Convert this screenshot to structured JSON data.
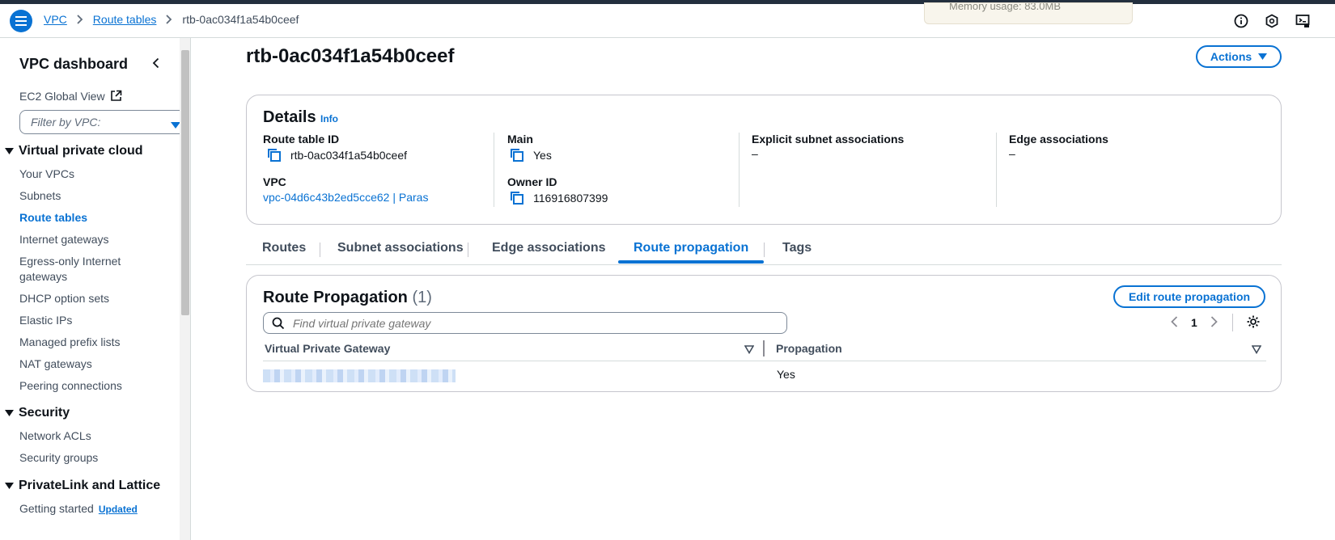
{
  "breadcrumb": {
    "items": [
      "VPC",
      "Route tables"
    ],
    "current": "rtb-0ac034f1a54b0ceef"
  },
  "notification": {
    "text": "Memory usage: 83.0MB"
  },
  "header_icons": [
    "info-icon",
    "feedback-icon",
    "cloudshell-icon"
  ],
  "sidebar": {
    "title": "VPC dashboard",
    "ec2_global_view": "EC2 Global View",
    "filter_placeholder": "Filter by VPC:",
    "sections": [
      {
        "title": "Virtual private cloud",
        "items": [
          "Your VPCs",
          "Subnets",
          "Route tables",
          "Internet gateways",
          "Egress-only Internet",
          "gateways",
          "DHCP option sets",
          "Elastic IPs",
          "Managed prefix lists",
          "NAT gateways",
          "Peering connections"
        ]
      },
      {
        "title": "Security",
        "items": [
          "Network ACLs",
          "Security groups"
        ]
      },
      {
        "title": "PrivateLink and Lattice",
        "items": [
          "Getting started"
        ],
        "badge": "Updated"
      }
    ],
    "active_item": "Route tables"
  },
  "page": {
    "title": "rtb-0ac034f1a54b0ceef",
    "actions_label": "Actions"
  },
  "details": {
    "heading": "Details",
    "info": "Info",
    "route_table_id_label": "Route table ID",
    "route_table_id": "rtb-0ac034f1a54b0ceef",
    "main_label": "Main",
    "main": "Yes",
    "explicit_label": "Explicit subnet associations",
    "explicit": "–",
    "edge_label": "Edge associations",
    "edge": "–",
    "vpc_label": "VPC",
    "vpc": "vpc-04d6c43b2ed5cce62 | Paras",
    "owner_label": "Owner ID",
    "owner": "116916807399"
  },
  "tabs": [
    "Routes",
    "Subnet associations",
    "Edge associations",
    "Route propagation",
    "Tags"
  ],
  "active_tab": "Route propagation",
  "propagation": {
    "title": "Route Propagation",
    "count": "(1)",
    "edit_label": "Edit route propagation",
    "search_placeholder": "Find virtual private gateway",
    "page": "1",
    "columns": [
      "Virtual Private Gateway",
      "Propagation"
    ],
    "rows": [
      {
        "propagation": "Yes"
      }
    ]
  },
  "colors": {
    "accent": "#0972d3",
    "text": "#0f141a",
    "border": "#c6c6cd"
  }
}
